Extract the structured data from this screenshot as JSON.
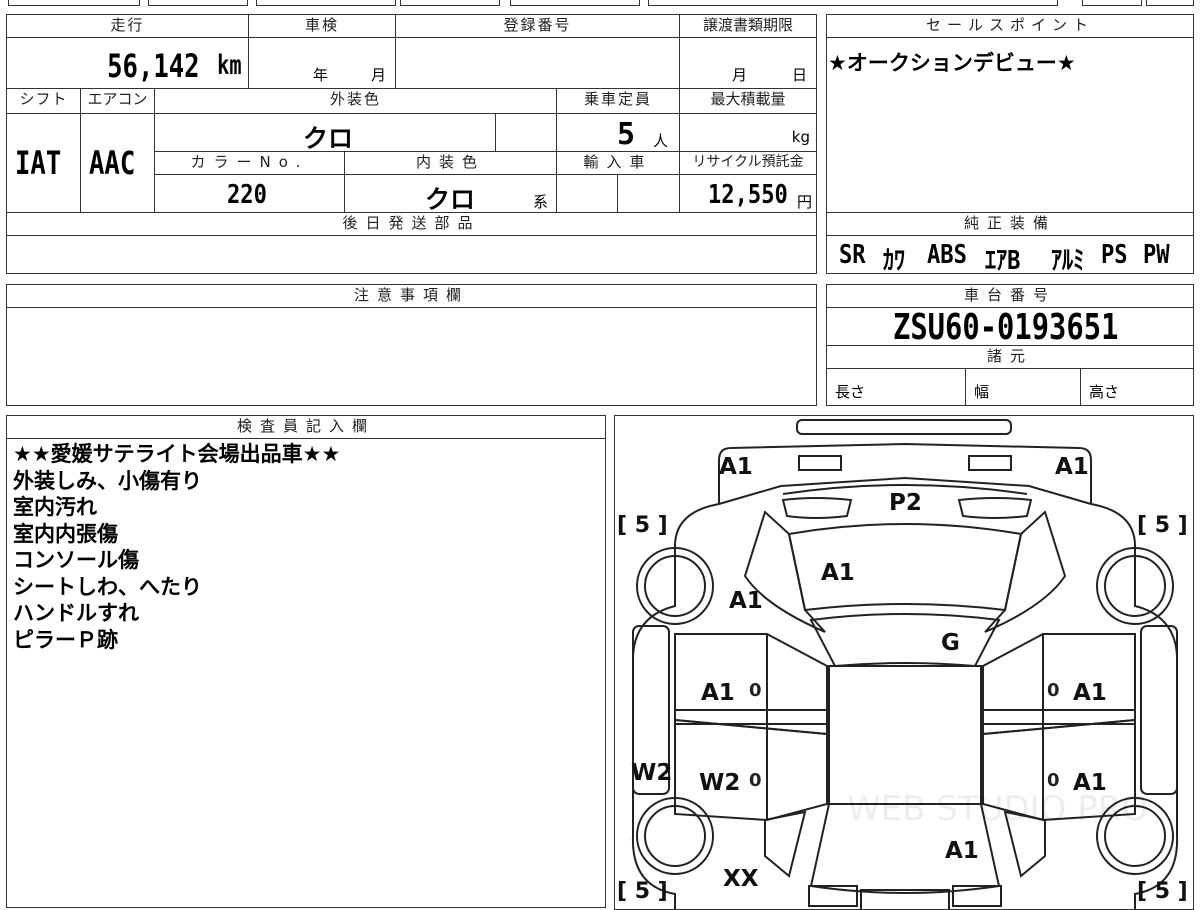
{
  "info": {
    "mileage_label": "走行",
    "mileage_value": "56,142",
    "mileage_unit": "km",
    "inspection_label": "車検",
    "inspection_year_unit": "年",
    "inspection_month_unit": "月",
    "registration_label": "登録番号",
    "transfer_label": "譲渡書類期限",
    "transfer_month_unit": "月",
    "transfer_day_unit": "日",
    "shift_label": "シフト",
    "shift_value": "IAT",
    "aircon_label": "エアコン",
    "aircon_value": "AAC",
    "exterior_label": "外装色",
    "exterior_value": "クロ",
    "capacity_label": "乗車定員",
    "capacity_value": "5",
    "capacity_unit": "人",
    "maxload_label": "最大積載量",
    "maxload_unit": "kg",
    "colorno_label": "カラーNo.",
    "colorno_value": "220",
    "interior_label": "内装色",
    "interior_value": "クロ",
    "interior_unit": "系",
    "import_label": "輸入車",
    "recycle_label": "リサイクル預託金",
    "recycle_value": "12,550",
    "recycle_unit": "円",
    "later_parts_label": "後日発送部品"
  },
  "sales": {
    "label": "セールスポイント",
    "text": "★オークションデビュー★"
  },
  "equipment": {
    "label": "純正装備",
    "items": [
      "SR",
      "ｶﾜ",
      "ABS",
      "ｴｱB",
      "ｱﾙﾐ",
      "PS",
      "PW"
    ]
  },
  "caution": {
    "label": "注意事項欄"
  },
  "chassis": {
    "label": "車台番号",
    "value": "ZSU60-0193651",
    "spec_label": "諸元",
    "length_label": "長さ",
    "width_label": "幅",
    "height_label": "高さ"
  },
  "inspector": {
    "label": "検査員記入欄",
    "lines": [
      "★★愛媛サテライト会場出品車★★",
      "外装しみ、小傷有り",
      "室内汚れ",
      "室内内張傷",
      "コンソール傷",
      "シートしわ、へたり",
      "ハンドルすれ",
      "ピラーＰ跡"
    ]
  },
  "diagram": {
    "marks": {
      "front_left": "A1",
      "front_right": "A1",
      "hood": "P2",
      "windshield": "A1",
      "left_fender": "A1",
      "roof": "G",
      "left_front_door": "A1",
      "right_front_door": "A1",
      "left_rear_door": "W2",
      "right_rear_door": "A1",
      "left_side": "W2",
      "rear_glass": "A1",
      "rear_left": "XX"
    },
    "tire_fl": "[ 5 ]",
    "tire_fr": "[ 5 ]",
    "tire_rl": "[ 5 ]",
    "tire_rr": "[ 5 ]",
    "zero": "0",
    "watermark": "WEB STUDIO PRO"
  }
}
